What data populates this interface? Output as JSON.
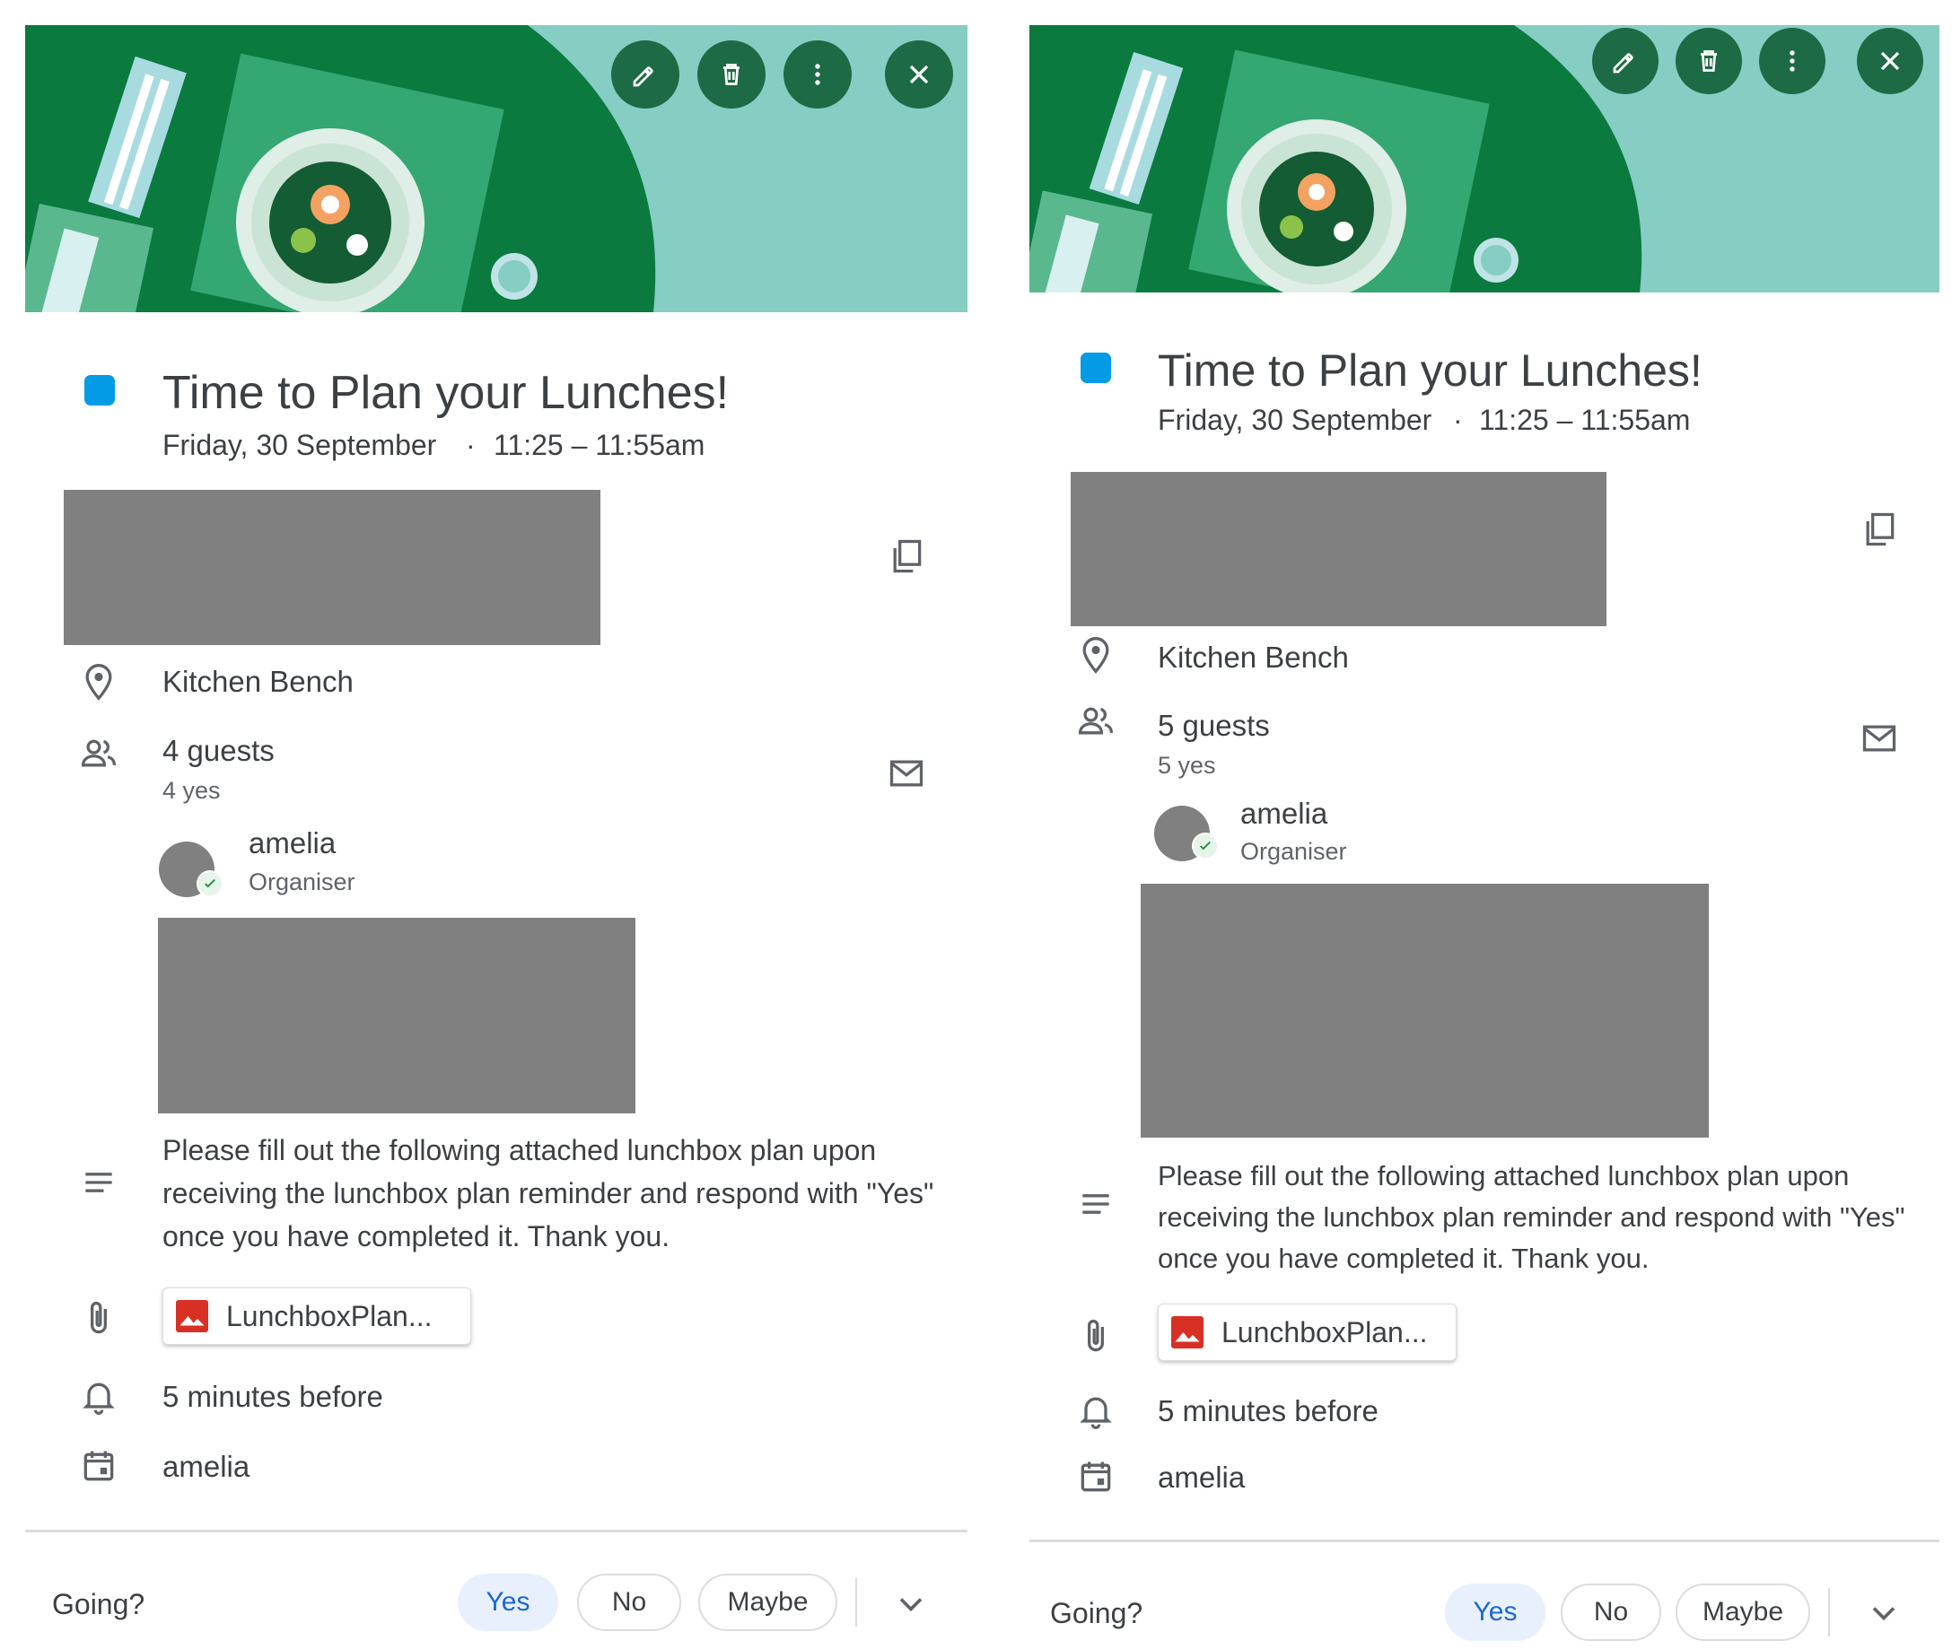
{
  "panels": [
    {
      "event": {
        "title": "Time to Plan your Lunches!",
        "date": "Friday, 30 September",
        "time_sep": "·",
        "time": "11:25 – 11:55am",
        "calendar_color": "#039be5"
      },
      "location": "Kitchen Bench",
      "guests": {
        "count_label": "4 guests",
        "yes_label": "4 yes",
        "organiser_name": "amelia",
        "organiser_role": "Organiser"
      },
      "description": "Please fill out the following attached lunchbox plan upon receiving the lunchbox plan reminder and respond with \"Yes\" once you have completed it. Thank you.",
      "attachment": {
        "name": "LunchboxPlan..."
      },
      "reminder": "5 minutes before",
      "calendar_owner": "amelia",
      "rsvp": {
        "label": "Going?",
        "yes": "Yes",
        "no": "No",
        "maybe": "Maybe",
        "selected": "Yes"
      },
      "toolbar_icons": [
        "edit-icon",
        "delete-icon",
        "more-icon",
        "close-icon"
      ]
    },
    {
      "event": {
        "title": "Time to Plan your Lunches!",
        "date": "Friday, 30 September",
        "time_sep": "·",
        "time": "11:25 – 11:55am",
        "calendar_color": "#039be5"
      },
      "location": "Kitchen Bench",
      "guests": {
        "count_label": "5 guests",
        "yes_label": "5 yes",
        "organiser_name": "amelia",
        "organiser_role": "Organiser"
      },
      "description": "Please fill out the following attached lunchbox plan upon receiving the lunchbox plan reminder and respond with \"Yes\" once you have completed it. Thank you.",
      "attachment": {
        "name": "LunchboxPlan..."
      },
      "reminder": "5 minutes before",
      "calendar_owner": "amelia",
      "rsvp": {
        "label": "Going?",
        "yes": "Yes",
        "no": "No",
        "maybe": "Maybe",
        "selected": "Yes"
      },
      "toolbar_icons": [
        "edit-icon",
        "delete-icon",
        "more-icon",
        "close-icon"
      ]
    }
  ],
  "colors": {
    "banner_bg": "#86cdc4",
    "table_green": "#0a7a3f",
    "button_bg": "#1d6b45",
    "accent_blue": "#1967d2",
    "redaction": "#808080"
  }
}
